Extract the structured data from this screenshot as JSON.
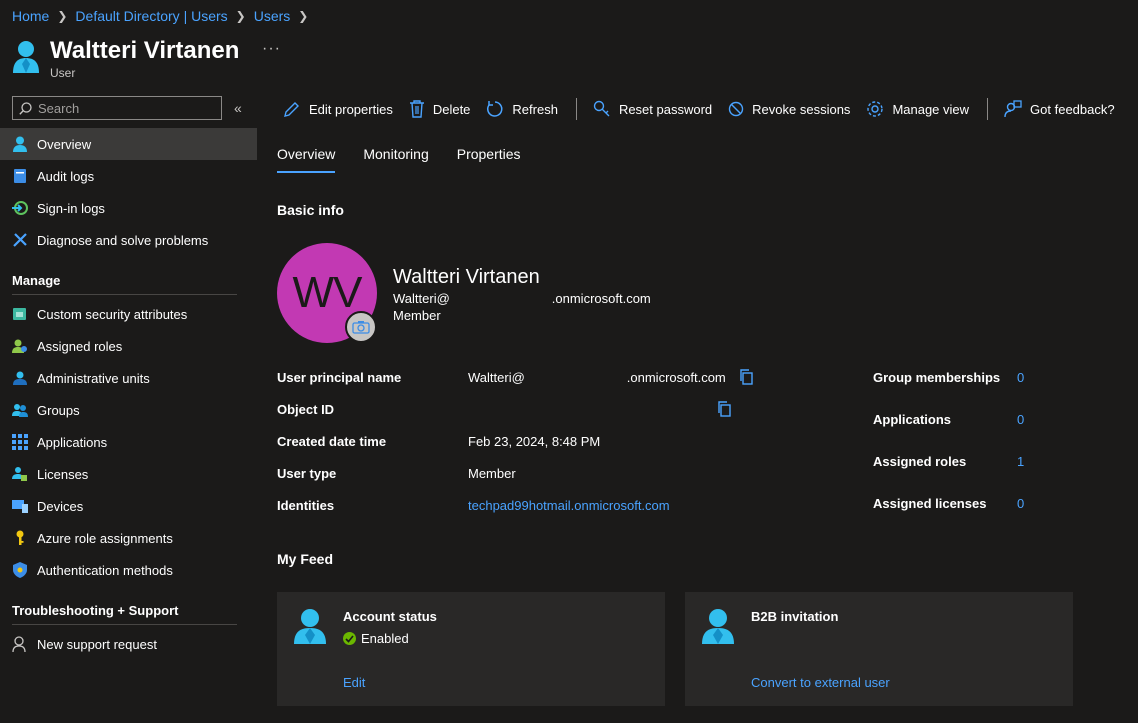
{
  "breadcrumb": [
    "Home",
    "Default Directory | Users",
    "Users"
  ],
  "header": {
    "title": "Waltteri Virtanen",
    "subtitle": "User",
    "more": "···"
  },
  "search": {
    "placeholder": "Search",
    "collapse": "«"
  },
  "nav": {
    "top": [
      {
        "label": "Overview",
        "icon": "user-icon"
      },
      {
        "label": "Audit logs",
        "icon": "audit-log-icon"
      },
      {
        "label": "Sign-in logs",
        "icon": "sign-in-icon"
      },
      {
        "label": "Diagnose and solve problems",
        "icon": "wrench-icon"
      }
    ],
    "manage_title": "Manage",
    "manage": [
      {
        "label": "Custom security attributes",
        "icon": "security-attributes-icon"
      },
      {
        "label": "Assigned roles",
        "icon": "roles-icon"
      },
      {
        "label": "Administrative units",
        "icon": "admin-units-icon"
      },
      {
        "label": "Groups",
        "icon": "groups-icon"
      },
      {
        "label": "Applications",
        "icon": "applications-grid-icon"
      },
      {
        "label": "Licenses",
        "icon": "licenses-icon"
      },
      {
        "label": "Devices",
        "icon": "devices-icon"
      },
      {
        "label": "Azure role assignments",
        "icon": "key-icon"
      },
      {
        "label": "Authentication methods",
        "icon": "shield-icon"
      }
    ],
    "support_title": "Troubleshooting + Support",
    "support": [
      {
        "label": "New support request",
        "icon": "support-person-icon"
      }
    ]
  },
  "toolbar": {
    "edit": "Edit properties",
    "delete": "Delete",
    "refresh": "Refresh",
    "reset_password": "Reset password",
    "revoke": "Revoke sessions",
    "manage_view": "Manage view",
    "feedback": "Got feedback?"
  },
  "tabs": [
    "Overview",
    "Monitoring",
    "Properties"
  ],
  "basic_info_title": "Basic info",
  "profile": {
    "initials": "WV",
    "name": "Waltteri Virtanen",
    "upn_prefix": "Waltteri@",
    "upn_suffix": ".onmicrosoft.com",
    "type": "Member",
    "avatar_color": "#c239b3"
  },
  "properties": {
    "upn_label": "User principal name",
    "upn_prefix": "Waltteri@",
    "upn_suffix": ".onmicrosoft.com",
    "object_id_label": "Object ID",
    "created_label": "Created date time",
    "created_value": "Feb 23, 2024, 8:48 PM",
    "user_type_label": "User type",
    "user_type_value": "Member",
    "identities_label": "Identities",
    "identities_value": "techpad99hotmail.onmicrosoft.com"
  },
  "stats": {
    "group_label": "Group memberships",
    "group_value": "0",
    "apps_label": "Applications",
    "apps_value": "0",
    "roles_label": "Assigned roles",
    "roles_value": "1",
    "licenses_label": "Assigned licenses",
    "licenses_value": "0"
  },
  "feed_title": "My Feed",
  "cards": {
    "account": {
      "title": "Account status",
      "status": "Enabled",
      "link": "Edit"
    },
    "b2b": {
      "title": "B2B invitation",
      "link": "Convert to external user"
    }
  },
  "colors": {
    "accent": "#4aa3ff",
    "background": "#1b1a19",
    "card": "#292827",
    "enabled": "#6bb700"
  }
}
